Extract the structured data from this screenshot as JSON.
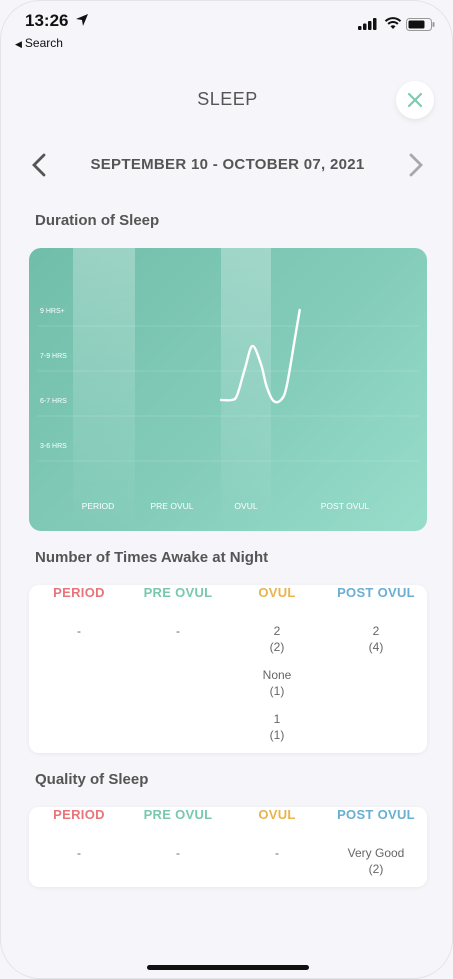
{
  "status_bar": {
    "time": "13:26",
    "back_label": "Search"
  },
  "header": {
    "title": "SLEEP",
    "date_range": "SEPTEMBER 10 - OCTOBER 07, 2021"
  },
  "phases": {
    "period": {
      "label": "PERIOD",
      "color": "#e8757a"
    },
    "pre_ovul": {
      "label": "PRE OVUL",
      "color": "#78c8b0"
    },
    "ovul": {
      "label": "OVUL",
      "color": "#e8b44c"
    },
    "post_ovul": {
      "label": "POST OVUL",
      "color": "#6aaed1"
    }
  },
  "duration": {
    "title": "Duration of Sleep",
    "chart_data": {
      "type": "line",
      "y_categories": [
        "3-6 HRS",
        "6-7 HRS",
        "7-9 HRS",
        "9 HRS+"
      ],
      "x_categories": [
        "PERIOD",
        "PRE OVUL",
        "OVUL",
        "POST OVUL"
      ],
      "series": [
        {
          "values": [
            [
              0.0,
              1.0
            ],
            [
              0.18,
              1.0
            ],
            [
              0.28,
              1.1
            ],
            [
              0.42,
              1.7
            ],
            [
              0.55,
              2.2
            ],
            [
              0.7,
              1.8
            ],
            [
              0.8,
              1.3
            ],
            [
              0.92,
              0.98
            ],
            [
              1.05,
              1.0
            ],
            [
              1.15,
              1.3
            ],
            [
              1.3,
              2.4
            ],
            [
              1.38,
              3.0
            ]
          ]
        }
      ]
    }
  },
  "awake": {
    "title": "Number of Times Awake at Night",
    "columns": {
      "period": [
        "-"
      ],
      "pre_ovul": [
        "-"
      ],
      "ovul": [
        [
          "2",
          "(2)"
        ],
        [
          "None",
          "(1)"
        ],
        [
          "1",
          "(1)"
        ]
      ],
      "post_ovul": [
        [
          "2",
          "(4)"
        ]
      ]
    }
  },
  "quality": {
    "title": "Quality of Sleep",
    "columns": {
      "period": "-",
      "pre_ovul": "-",
      "ovul": "-",
      "post_ovul": [
        "Very Good",
        "(2)"
      ]
    }
  }
}
